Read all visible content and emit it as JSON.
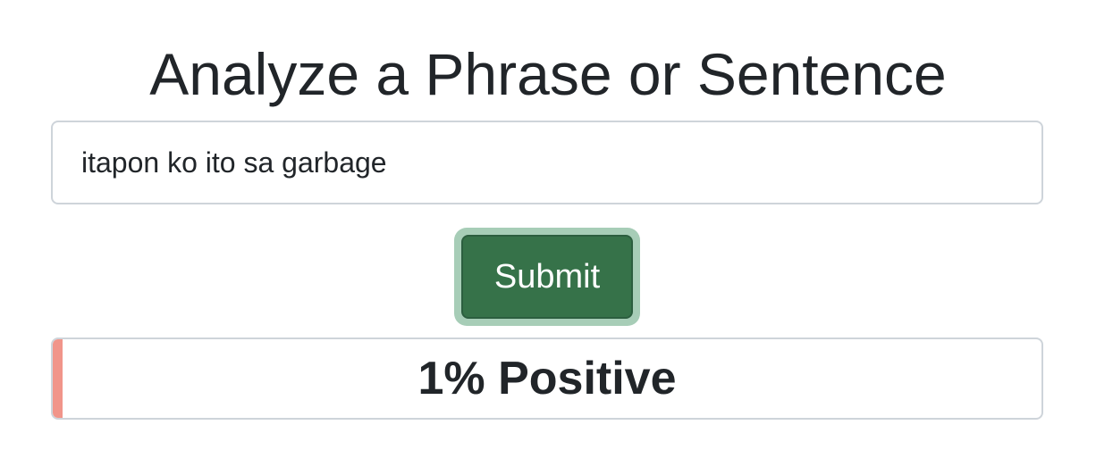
{
  "header": {
    "title": "Analyze a Phrase or Sentence"
  },
  "form": {
    "phrase_value": "itapon ko ito sa garbage",
    "submit_label": "Submit"
  },
  "result": {
    "label": "1% Positive",
    "positive_fraction": 0.01
  },
  "colors": {
    "submit_bg": "#367249",
    "submit_focus_ring": "#a7cdb7",
    "result_fill": "#f1958a",
    "border": "#ced4da",
    "text": "#212529"
  }
}
